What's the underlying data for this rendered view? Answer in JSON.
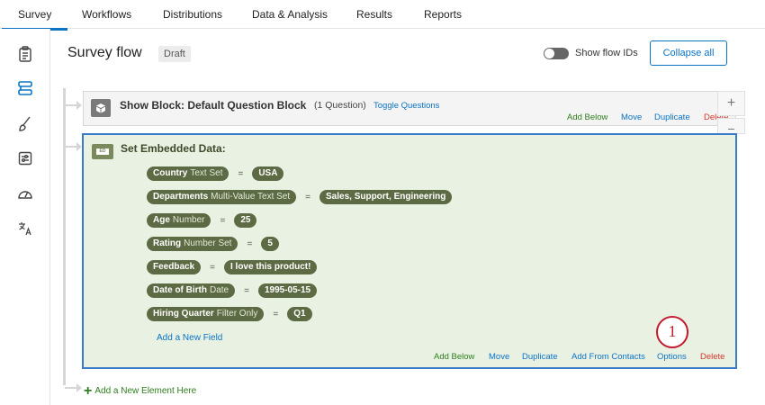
{
  "nav": {
    "tabs": [
      {
        "label": "Survey"
      },
      {
        "label": "Workflows"
      },
      {
        "label": "Distributions"
      },
      {
        "label": "Data & Analysis"
      },
      {
        "label": "Results"
      },
      {
        "label": "Reports"
      }
    ],
    "active_tab": "Survey"
  },
  "sidebar": {
    "items": [
      {
        "icon": "clipboard-icon"
      },
      {
        "icon": "survey-flow-icon",
        "active": true
      },
      {
        "icon": "brush-icon"
      },
      {
        "icon": "sliders-icon"
      },
      {
        "icon": "gauge-icon"
      },
      {
        "icon": "translate-icon"
      }
    ]
  },
  "header": {
    "title": "Survey flow",
    "status": "Draft",
    "toggle_label": "Show flow IDs",
    "collapse_label": "Collapse all"
  },
  "block1": {
    "title": "Show Block: Default Question Block",
    "count": "(1 Question)",
    "toggle": "Toggle Questions",
    "actions": {
      "add_below": "Add Below",
      "move": "Move",
      "duplicate": "Duplicate",
      "delete": "Delete"
    }
  },
  "block2": {
    "icon_text": "ED",
    "title": "Set Embedded Data:",
    "fields": [
      {
        "name": "Country",
        "type": "Text Set",
        "eq": "=",
        "value": "USA"
      },
      {
        "name": "Departments",
        "type": "Multi-Value Text Set",
        "eq": "=",
        "value": "Sales, Support, Engineering"
      },
      {
        "name": "Age",
        "type": "Number",
        "eq": "=",
        "value": "25"
      },
      {
        "name": "Rating",
        "type": "Number Set",
        "eq": "=",
        "value": "5"
      },
      {
        "name": "Feedback",
        "type": "",
        "eq": "=",
        "value": "I love this product!"
      },
      {
        "name": "Date of Birth",
        "type": "Date",
        "eq": "=",
        "value": "1995-05-15"
      },
      {
        "name": "Hiring Quarter",
        "type": "Filter Only",
        "eq": "=",
        "value": "Q1"
      }
    ],
    "add_field": "Add a New Field",
    "actions": {
      "add_below": "Add Below",
      "move": "Move",
      "duplicate": "Duplicate",
      "add_from_contacts": "Add From Contacts",
      "options": "Options",
      "delete": "Delete"
    }
  },
  "callout": "1",
  "add_element": "Add a New Element Here",
  "colors": {
    "accent": "#0b73c4",
    "green": "#2e7d1e",
    "delete": "#d1372a",
    "pill": "#5d6b45",
    "callout": "#c21b2e"
  }
}
